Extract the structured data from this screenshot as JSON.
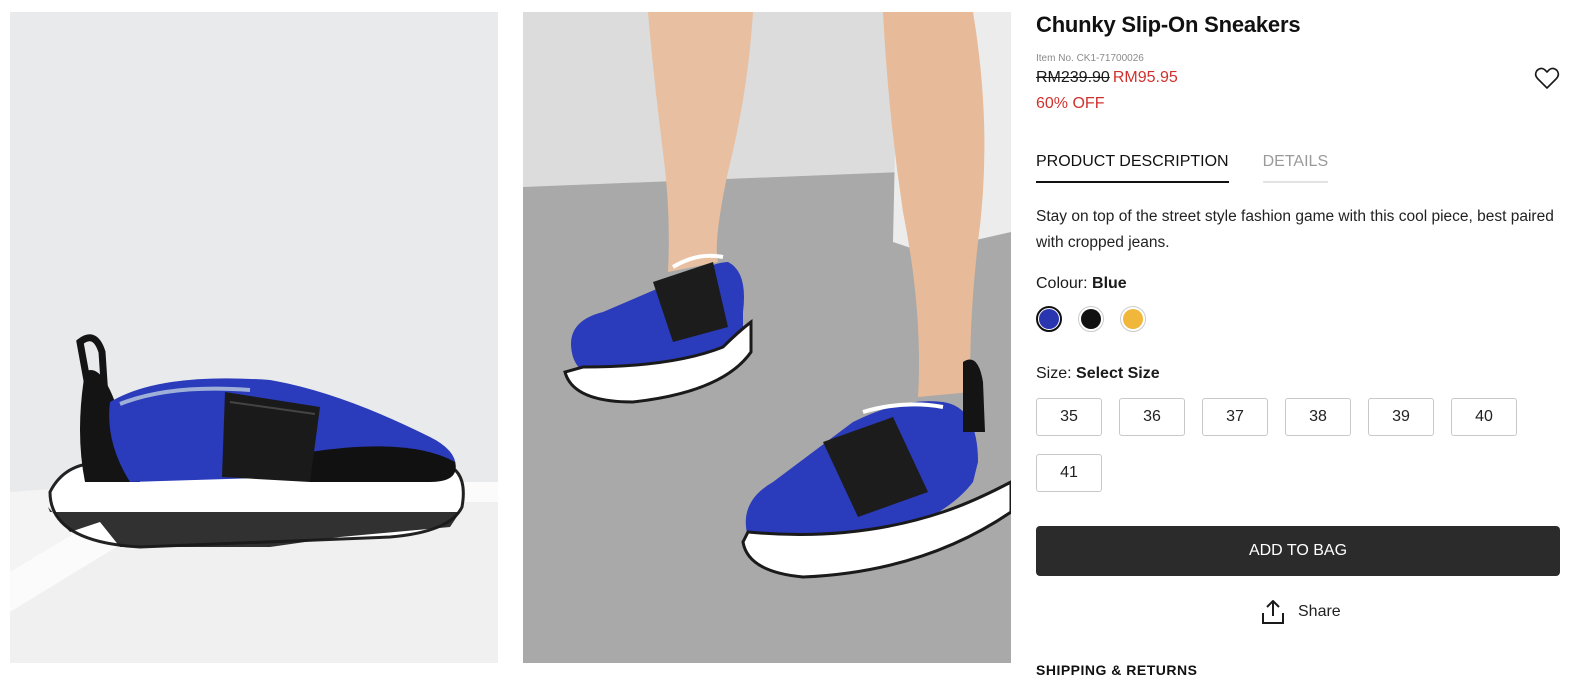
{
  "product": {
    "title": "Chunky Slip-On Sneakers",
    "item_no": "Item No. CK1-71700026",
    "old_price": "RM239.90",
    "new_price": "RM95.95",
    "discount": "60% OFF"
  },
  "tabs": [
    {
      "label": "PRODUCT DESCRIPTION",
      "active": true
    },
    {
      "label": "DETAILS",
      "active": false
    }
  ],
  "description": "Stay on top of the street style fashion game with this cool piece, best paired with cropped jeans.",
  "colour": {
    "label": "Colour:",
    "selected": "Blue",
    "options": [
      {
        "name": "Blue",
        "hex": "#2a35b0"
      },
      {
        "name": "Black",
        "hex": "#111111"
      },
      {
        "name": "Yellow",
        "hex": "#f0b73a"
      }
    ]
  },
  "size": {
    "label": "Size:",
    "selected": "Select Size",
    "options": [
      "35",
      "36",
      "37",
      "38",
      "39",
      "40",
      "41"
    ]
  },
  "actions": {
    "add_to_bag": "ADD TO BAG",
    "share": "Share"
  },
  "icons": {
    "wishlist": "heart-outline-icon",
    "share": "share-upload-icon"
  },
  "sections": {
    "shipping": "SHIPPING & RETURNS"
  },
  "colors": {
    "sale": "#d0312d",
    "button": "#2b2b2b"
  }
}
